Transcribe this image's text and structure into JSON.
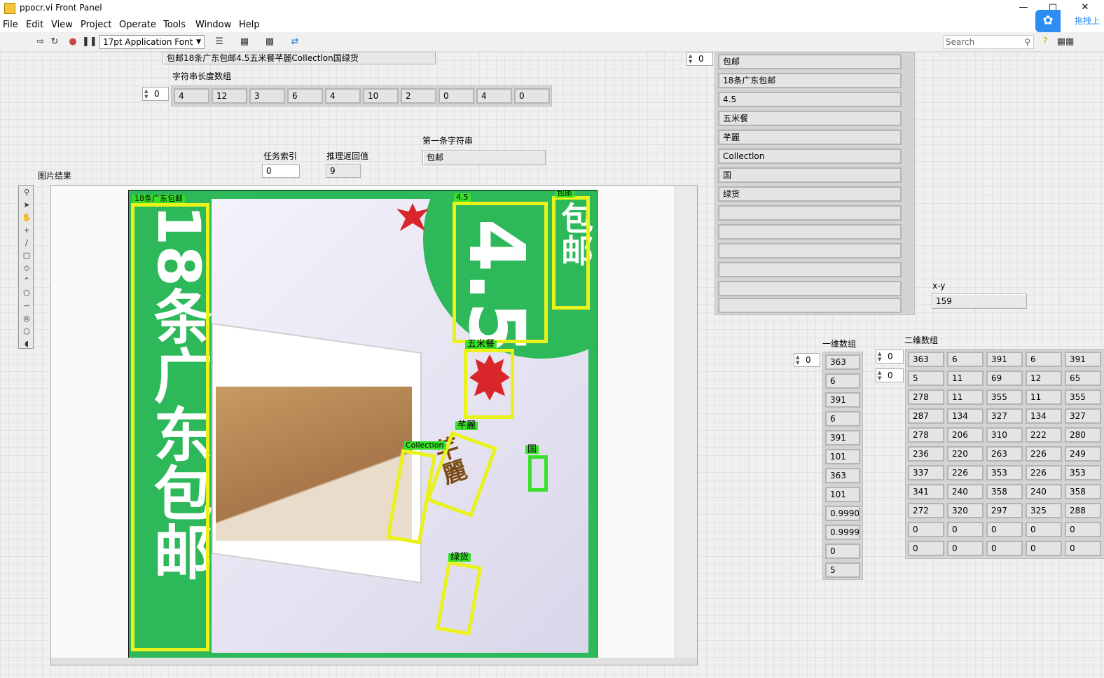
{
  "window": {
    "title": "ppocr.vi Front Panel",
    "minimize": "—",
    "maximize": "□",
    "close": "✕"
  },
  "menu": [
    "File",
    "Edit",
    "View",
    "Project",
    "Operate",
    "Tools",
    "Window",
    "Help"
  ],
  "baidu_badge": {
    "text": "拖拽上"
  },
  "toolbar": {
    "font": "17pt Application Font",
    "search_placeholder": "Search"
  },
  "concat_string": "包邮18条广东包邮4.5五米餐芊麗Collectlon国绿货",
  "string_length_array": {
    "label": "字符串长度数组",
    "index": "0",
    "values": [
      "4",
      "12",
      "3",
      "6",
      "4",
      "10",
      "2",
      "0",
      "4",
      "0"
    ]
  },
  "task_index": {
    "label": "任务索引",
    "value": "0"
  },
  "infer_return": {
    "label": "推理返回值",
    "value": "9"
  },
  "first_string": {
    "label": "第一条字符串",
    "value": "包邮"
  },
  "image_result": {
    "label": "图片结果",
    "detections": [
      {
        "text": "18条广东包邮",
        "big": "18条广东包邮"
      },
      {
        "text": "4.5",
        "big": "4.5"
      },
      {
        "text": "包邮",
        "big": "包邮"
      },
      {
        "text": "五米餐",
        "big": ""
      },
      {
        "text": "芊麗",
        "big": "芊麗"
      },
      {
        "text": "Collection",
        "big": ""
      },
      {
        "text": "国",
        "big": ""
      },
      {
        "text": "绿货",
        "big": ""
      }
    ]
  },
  "string_array": {
    "index": "0",
    "values": [
      "包邮",
      "18条广东包邮",
      "4.5",
      "五米餐",
      "芊麗",
      "Collectlon",
      "国",
      "绿货",
      "",
      "",
      "",
      "",
      "",
      ""
    ]
  },
  "xy": {
    "label": "x-y",
    "value": "159"
  },
  "array_1d": {
    "label": "一维数组",
    "index": "0",
    "values": [
      "363",
      "6",
      "391",
      "6",
      "391",
      "101",
      "363",
      "101",
      "0.99905",
      "0.99999",
      "0",
      "5"
    ]
  },
  "array_2d": {
    "label": "二维数组",
    "row_index": "0",
    "col_index": "0",
    "rows": [
      [
        "363",
        "6",
        "391",
        "6",
        "391"
      ],
      [
        "5",
        "11",
        "69",
        "12",
        "65"
      ],
      [
        "278",
        "11",
        "355",
        "11",
        "355"
      ],
      [
        "287",
        "134",
        "327",
        "134",
        "327"
      ],
      [
        "278",
        "206",
        "310",
        "222",
        "280"
      ],
      [
        "236",
        "220",
        "263",
        "226",
        "249"
      ],
      [
        "337",
        "226",
        "353",
        "226",
        "353"
      ],
      [
        "341",
        "240",
        "358",
        "240",
        "358"
      ],
      [
        "272",
        "320",
        "297",
        "325",
        "288"
      ],
      [
        "0",
        "0",
        "0",
        "0",
        "0"
      ],
      [
        "0",
        "0",
        "0",
        "0",
        "0"
      ]
    ]
  }
}
